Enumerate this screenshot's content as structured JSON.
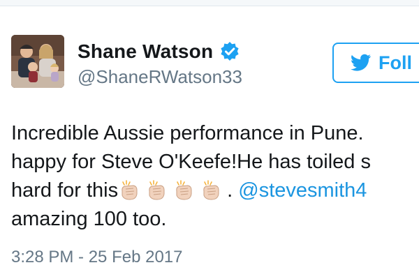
{
  "tweet": {
    "author": {
      "display_name": "Shane Watson",
      "handle": "@ShaneRWatson33",
      "verified": true,
      "avatar_icon": "family-photo-avatar"
    },
    "follow_button": {
      "label": "Foll",
      "icon": "twitter-bird-icon",
      "color": "#1da1f2"
    },
    "text_lines": [
      "Incredible Aussie performance in Pune.",
      "happy for Steve O'Keefe!He has toiled s",
      "hard for this",
      "amazing 100 too."
    ],
    "line3_after_emoji": ". ",
    "mention": "@stevesmith4",
    "emoji": [
      "clapping-hands-icon",
      "clapping-hands-icon",
      "clapping-hands-icon",
      "clapping-hands-icon"
    ],
    "timestamp": "3:28 PM - 25 Feb 2017",
    "colors": {
      "text": "#14171a",
      "secondary": "#657786",
      "link": "#1b95e0",
      "verified": "#1da1f2"
    }
  }
}
